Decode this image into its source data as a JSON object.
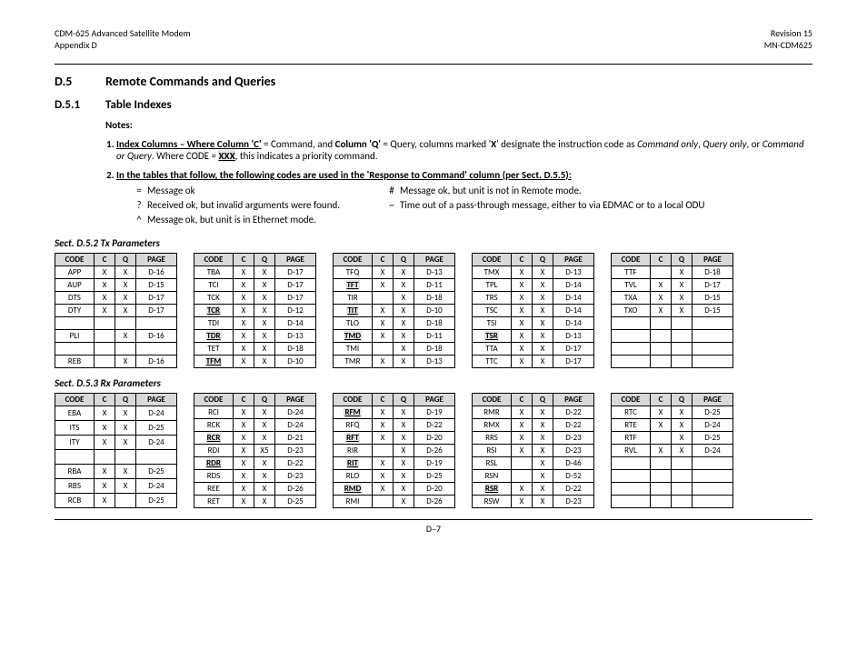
{
  "header": {
    "left1": "CDM-625 Advanced Satellite Modem",
    "left2": "Appendix D",
    "right1": "Revision 15",
    "right2": "MN-CDM625"
  },
  "headings": {
    "d5_num": "D.5",
    "d5_title": "Remote Commands and Queries",
    "d51_num": "D.5.1",
    "d51_title": "Table Indexes"
  },
  "notes": {
    "label": "Notes:",
    "item1_a": "Index Columns – Where Column 'C'",
    "item1_b": " = Command, and ",
    "item1_c": "Column 'Q'",
    "item1_d": " = Query, columns marked '",
    "item1_e": "X",
    "item1_f": "' designate the instruction code as ",
    "item1_g": "Command only",
    "item1_h": ", ",
    "item1_i": "Query only",
    "item1_j": ", or ",
    "item1_k": "Command or Query",
    "item1_l": ".  Where ",
    "item1_m": "CODE = ",
    "item1_n": "XXX",
    "item1_o": ", this indicates a priority command.",
    "item2": "In the tables that follow, the following codes are used in the 'Response to Command' column (per Sect. D.5.5):"
  },
  "legend": {
    "l1": {
      "sym": "=",
      "txt": "Message ok"
    },
    "l2": {
      "sym": "?",
      "txt": "Received ok, but invalid arguments were found."
    },
    "l3": {
      "sym": "^",
      "txt_a": "Message ok, but unit is in ",
      "txt_b": "Ethernet",
      "txt_c": " mode."
    },
    "r1": {
      "sym": "#",
      "txt_a": "Message ok, but unit is not in ",
      "txt_b": "Remote",
      "txt_c": " mode."
    },
    "r2": {
      "sym": "~",
      "txt": "Time out of a pass-through message, either to via EDMAC or to a local ODU"
    }
  },
  "sections": {
    "tx": "Sect. D.5.2 Tx Parameters",
    "rx": "Sect. D.5.3 Rx Parameters"
  },
  "th": {
    "code": "CODE",
    "c": "C",
    "q": "Q",
    "page": "PAGE"
  },
  "footer": "D–7",
  "tx_tables": [
    [
      {
        "code": "APP",
        "c": "X",
        "q": "X",
        "page": "D-16"
      },
      {
        "code": "AUP",
        "c": "X",
        "q": "X",
        "page": "D-15"
      },
      {
        "code": "DTS",
        "c": "X",
        "q": "X",
        "page": "D-17"
      },
      {
        "code": "DTY",
        "c": "X",
        "q": "X",
        "page": "D-17"
      },
      {
        "code": "",
        "c": "",
        "q": "",
        "page": ""
      },
      {
        "code": "PLI",
        "c": "",
        "q": "X",
        "page": "D-16"
      },
      {
        "code": "",
        "c": "",
        "q": "",
        "page": ""
      },
      {
        "code": "REB",
        "c": "",
        "q": "X",
        "page": "D-16"
      }
    ],
    [
      {
        "code": "TBA",
        "c": "X",
        "q": "X",
        "page": "D-17"
      },
      {
        "code": "TCI",
        "c": "X",
        "q": "X",
        "page": "D-17"
      },
      {
        "code": "TCK",
        "c": "X",
        "q": "X",
        "page": "D-17"
      },
      {
        "code": "TCR",
        "pri": true,
        "c": "X",
        "q": "X",
        "page": "D-12"
      },
      {
        "code": "TDI",
        "c": "X",
        "q": "X",
        "page": "D-14"
      },
      {
        "code": "TDR",
        "pri": true,
        "c": "X",
        "q": "X",
        "page": "D-13"
      },
      {
        "code": "TET",
        "c": "X",
        "q": "X",
        "page": "D-18"
      },
      {
        "code": "TFM",
        "pri": true,
        "c": "X",
        "q": "X",
        "page": "D-10"
      }
    ],
    [
      {
        "code": "TFQ",
        "c": "X",
        "q": "X",
        "page": "D-13"
      },
      {
        "code": "TFT",
        "pri": true,
        "c": "X",
        "q": "X",
        "page": "D-11"
      },
      {
        "code": "TIR",
        "c": "",
        "q": "X",
        "page": "D-18"
      },
      {
        "code": "TIT",
        "pri": true,
        "c": "X",
        "q": "X",
        "page": "D-10"
      },
      {
        "code": "TLO",
        "c": "X",
        "q": "X",
        "page": "D-18"
      },
      {
        "code": "TMD",
        "pri": true,
        "c": "X",
        "q": "X",
        "page": "D-11"
      },
      {
        "code": "TMI",
        "c": "",
        "q": "X",
        "page": "D-18"
      },
      {
        "code": "TMR",
        "c": "X",
        "q": "X",
        "page": "D-13"
      }
    ],
    [
      {
        "code": "TMX",
        "c": "X",
        "q": "X",
        "page": "D-13"
      },
      {
        "code": "TPL",
        "c": "X",
        "q": "X",
        "page": "D-14"
      },
      {
        "code": "TRS",
        "c": "X",
        "q": "X",
        "page": "D-14"
      },
      {
        "code": "TSC",
        "c": "X",
        "q": "X",
        "page": "D-14"
      },
      {
        "code": "TSI",
        "c": "X",
        "q": "X",
        "page": "D-14"
      },
      {
        "code": "TSR",
        "pri": true,
        "c": "X",
        "q": "X",
        "page": "D-13"
      },
      {
        "code": "TTA",
        "c": "X",
        "q": "X",
        "page": "D-17"
      },
      {
        "code": "TTC",
        "c": "X",
        "q": "X",
        "page": "D-17"
      }
    ],
    [
      {
        "code": "TTF",
        "c": "",
        "q": "X",
        "page": "D-18"
      },
      {
        "code": "TVL",
        "c": "X",
        "q": "X",
        "page": "D-17"
      },
      {
        "code": "TXA",
        "c": "X",
        "q": "X",
        "page": "D-15"
      },
      {
        "code": "TXO",
        "c": "X",
        "q": "X",
        "page": "D-15"
      },
      {
        "code": "",
        "c": "",
        "q": "",
        "page": ""
      },
      {
        "code": "",
        "c": "",
        "q": "",
        "page": ""
      },
      {
        "code": "",
        "c": "",
        "q": "",
        "page": ""
      },
      {
        "code": "",
        "c": "",
        "q": "",
        "page": ""
      }
    ]
  ],
  "rx_tables": [
    [
      {
        "code": "EBA",
        "c": "X",
        "q": "X",
        "page": "D-24"
      },
      {
        "code": "ITS",
        "c": "X",
        "q": "X",
        "page": "D-25"
      },
      {
        "code": "ITY",
        "c": "X",
        "q": "X",
        "page": "D-24"
      },
      {
        "code": "",
        "c": "",
        "q": "",
        "page": ""
      },
      {
        "code": "RBA",
        "c": "X",
        "q": "X",
        "page": "D-25"
      },
      {
        "code": "RBS",
        "c": "X",
        "q": "X",
        "page": "D-24"
      },
      {
        "code": "RCB",
        "c": "X",
        "q": "",
        "page": "D-25"
      }
    ],
    [
      {
        "code": "RCI",
        "c": "X",
        "q": "X",
        "page": "D-24"
      },
      {
        "code": "RCK",
        "c": "X",
        "q": "X",
        "page": "D-24"
      },
      {
        "code": "RCR",
        "pri": true,
        "c": "X",
        "q": "X",
        "page": "D-21"
      },
      {
        "code": "RDI",
        "c": "X",
        "q": "X5",
        "page": "D-23"
      },
      {
        "code": "RDR",
        "pri": true,
        "c": "X",
        "q": "X",
        "page": "D-22"
      },
      {
        "code": "RDS",
        "c": "X",
        "q": "X",
        "page": "D-23"
      },
      {
        "code": "REE",
        "c": "X",
        "q": "X",
        "page": "D-26"
      },
      {
        "code": "RET",
        "c": "X",
        "q": "X",
        "page": "D-25"
      }
    ],
    [
      {
        "code": "RFM",
        "pri": true,
        "c": "X",
        "q": "X",
        "page": "D-19"
      },
      {
        "code": "RFQ",
        "c": "X",
        "q": "X",
        "page": "D-22"
      },
      {
        "code": "RFT",
        "pri": true,
        "c": "X",
        "q": "X",
        "page": "D-20"
      },
      {
        "code": "RIR",
        "c": "",
        "q": "X",
        "page": "D-26"
      },
      {
        "code": "RIT",
        "pri": true,
        "c": "X",
        "q": "X",
        "page": "D-19"
      },
      {
        "code": "RLO",
        "c": "X",
        "q": "X",
        "page": "D-25"
      },
      {
        "code": "RMD",
        "pri": true,
        "c": "X",
        "q": "X",
        "page": "D-20"
      },
      {
        "code": "RMI",
        "c": "",
        "q": "X",
        "page": "D-26"
      }
    ],
    [
      {
        "code": "RMR",
        "c": "X",
        "q": "X",
        "page": "D-22"
      },
      {
        "code": "RMX",
        "c": "X",
        "q": "X",
        "page": "D-22"
      },
      {
        "code": "RRS",
        "c": "X",
        "q": "X",
        "page": "D-23"
      },
      {
        "code": "RSI",
        "c": "X",
        "q": "X",
        "page": "D-23"
      },
      {
        "code": "RSL",
        "c": "",
        "q": "X",
        "page": "D-46"
      },
      {
        "code": "RSN",
        "c": "",
        "q": "X",
        "page": "D-52"
      },
      {
        "code": "RSR",
        "pri": true,
        "c": "X",
        "q": "X",
        "page": "D-22"
      },
      {
        "code": "RSW",
        "c": "X",
        "q": "X",
        "page": "D-23"
      }
    ],
    [
      {
        "code": "RTC",
        "c": "X",
        "q": "X",
        "page": "D-25"
      },
      {
        "code": "RTE",
        "c": "X",
        "q": "X",
        "page": "D-24"
      },
      {
        "code": "RTF",
        "c": "",
        "q": "X",
        "page": "D-25"
      },
      {
        "code": "RVL",
        "c": "X",
        "q": "X",
        "page": "D-24"
      },
      {
        "code": "",
        "c": "",
        "q": "",
        "page": ""
      },
      {
        "code": "",
        "c": "",
        "q": "",
        "page": ""
      },
      {
        "code": "",
        "c": "",
        "q": "",
        "page": ""
      },
      {
        "code": "",
        "c": "",
        "q": "",
        "page": ""
      }
    ]
  ]
}
